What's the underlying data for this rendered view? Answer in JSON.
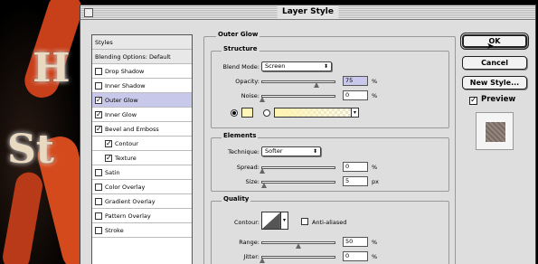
{
  "window": {
    "title": "Layer Style"
  },
  "styles_list": {
    "items": [
      {
        "label": "Styles",
        "checkbox": false,
        "checked": false,
        "indent": false,
        "selected": false,
        "header": true
      },
      {
        "label": "Blending Options: Default",
        "checkbox": false,
        "checked": false,
        "indent": false,
        "selected": false,
        "header": true
      },
      {
        "label": "Drop Shadow",
        "checkbox": true,
        "checked": false,
        "indent": false,
        "selected": false
      },
      {
        "label": "Inner Shadow",
        "checkbox": true,
        "checked": false,
        "indent": false,
        "selected": false
      },
      {
        "label": "Outer Glow",
        "checkbox": true,
        "checked": true,
        "indent": false,
        "selected": true
      },
      {
        "label": "Inner Glow",
        "checkbox": true,
        "checked": true,
        "indent": false,
        "selected": false
      },
      {
        "label": "Bevel and Emboss",
        "checkbox": true,
        "checked": true,
        "indent": false,
        "selected": false
      },
      {
        "label": "Contour",
        "checkbox": true,
        "checked": true,
        "indent": true,
        "selected": false
      },
      {
        "label": "Texture",
        "checkbox": true,
        "checked": true,
        "indent": true,
        "selected": false
      },
      {
        "label": "Satin",
        "checkbox": true,
        "checked": false,
        "indent": false,
        "selected": false
      },
      {
        "label": "Color Overlay",
        "checkbox": true,
        "checked": false,
        "indent": false,
        "selected": false
      },
      {
        "label": "Gradient Overlay",
        "checkbox": true,
        "checked": false,
        "indent": false,
        "selected": false
      },
      {
        "label": "Pattern Overlay",
        "checkbox": true,
        "checked": false,
        "indent": false,
        "selected": false
      },
      {
        "label": "Stroke",
        "checkbox": true,
        "checked": false,
        "indent": false,
        "selected": false
      }
    ]
  },
  "outer_glow": {
    "section_title": "Outer Glow",
    "structure": {
      "title": "Structure",
      "blend_mode_label": "Blend Mode:",
      "blend_mode_value": "Screen",
      "opacity_label": "Opacity:",
      "opacity_value": "75",
      "opacity_unit": "%",
      "opacity_level": 0.75,
      "noise_label": "Noise:",
      "noise_value": "0",
      "noise_unit": "%",
      "noise_level": 0.0,
      "color_mode": "solid",
      "glow_color": "#fff6b8"
    },
    "elements": {
      "title": "Elements",
      "technique_label": "Technique:",
      "technique_value": "Softer",
      "spread_label": "Spread:",
      "spread_value": "0",
      "spread_unit": "%",
      "spread_level": 0.0,
      "size_label": "Size:",
      "size_value": "5",
      "size_unit": "px",
      "size_level": 0.02
    },
    "quality": {
      "title": "Quality",
      "contour_label": "Contour:",
      "anti_aliased_label": "Anti-aliased",
      "anti_aliased": false,
      "range_label": "Range:",
      "range_value": "50",
      "range_unit": "%",
      "range_level": 0.5,
      "jitter_label": "Jitter:",
      "jitter_value": "0",
      "jitter_unit": "%",
      "jitter_level": 0.0
    }
  },
  "buttons": {
    "ok": "OK",
    "cancel": "Cancel",
    "new_style": "New Style...",
    "preview_label": "Preview",
    "preview_checked": true
  }
}
